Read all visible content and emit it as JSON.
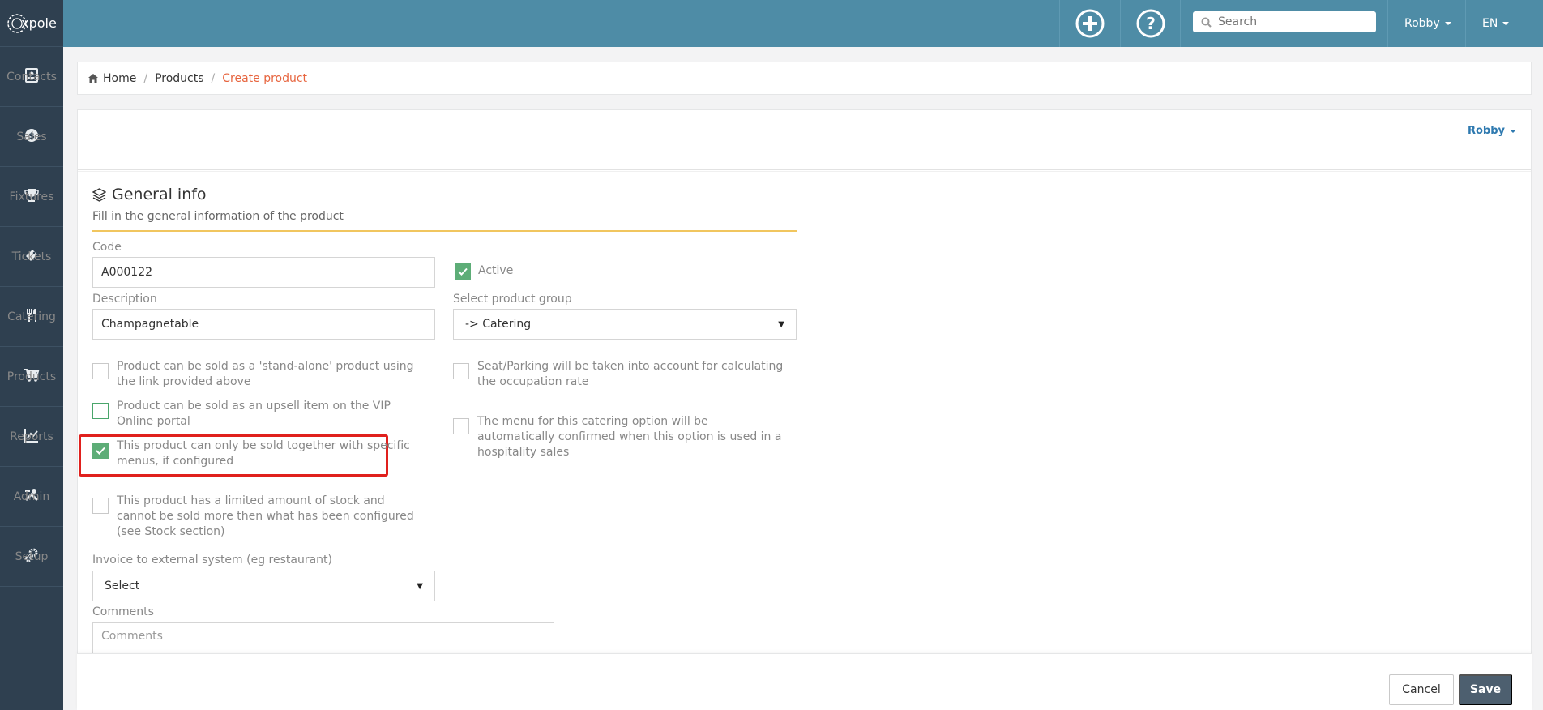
{
  "app": {
    "logo_text": "xpole"
  },
  "sidebar": {
    "items": [
      {
        "label": "Contacts",
        "icon": "address-book-icon"
      },
      {
        "label": "Sales",
        "icon": "dollar-icon"
      },
      {
        "label": "Fixtures",
        "icon": "trophy-icon"
      },
      {
        "label": "Tickets",
        "icon": "ticket-icon"
      },
      {
        "label": "Catering",
        "icon": "cutlery-icon"
      },
      {
        "label": "Products",
        "icon": "cart-icon"
      },
      {
        "label": "Reports",
        "icon": "line-chart-icon"
      },
      {
        "label": "Admin",
        "icon": "tools-icon"
      },
      {
        "label": "Setup",
        "icon": "gears-icon"
      }
    ]
  },
  "topbar": {
    "search_placeholder": "Search",
    "user": "Robby",
    "language": "EN"
  },
  "breadcrumb": {
    "home": "Home",
    "products": "Products",
    "current": "Create product",
    "separator": "/"
  },
  "panel": {
    "user": "Robby",
    "section_title": "General info",
    "section_subtitle": "Fill in the general information of the product"
  },
  "form": {
    "code_label": "Code",
    "code_value": "A000122",
    "active_label": "Active",
    "description_label": "Description",
    "description_value": "Champagnetable",
    "product_group_label": "Select product group",
    "product_group_value": "-> Catering",
    "cb_standalone_l1": "Product can be sold as a 'stand-alone' product using",
    "cb_standalone_l2": "the link provided above",
    "cb_seat_l1": "Seat/Parking will be taken into account for calculating",
    "cb_seat_l2": "the occupation rate",
    "cb_upsell_l1": "Product can be sold as an upsell item on the VIP",
    "cb_upsell_l2": "Online portal",
    "cb_menu_confirm_l1": "The menu for this catering option will be",
    "cb_menu_confirm_l2": "automatically confirmed when this option is used in a",
    "cb_menu_confirm_l3": "hospitality sales",
    "cb_specific_menus_l1": "This product can only be sold together with specific",
    "cb_specific_menus_l2": "menus, if configured",
    "cb_stock_l1": "This product has a limited amount of stock and",
    "cb_stock_l2": "cannot be sold more then what has been configured",
    "cb_stock_l3": "(see Stock section)",
    "invoice_label": "Invoice to external system (eg restaurant)",
    "invoice_value": "Select",
    "comments_label": "Comments",
    "comments_placeholder": "Comments"
  },
  "checkbox_states": {
    "active": true,
    "standalone": false,
    "seat": false,
    "upsell": false,
    "menu_confirm": false,
    "specific_menus": true,
    "stock": false
  },
  "footer": {
    "cancel": "Cancel",
    "save": "Save"
  },
  "colors": {
    "sidebar_bg": "#2f4050",
    "topbar_bg": "#4e8ca6",
    "accent_orange": "#e7653f",
    "check_green": "#5dad77",
    "highlight_red": "#e0201d",
    "save_bg": "#4d5f6f"
  }
}
